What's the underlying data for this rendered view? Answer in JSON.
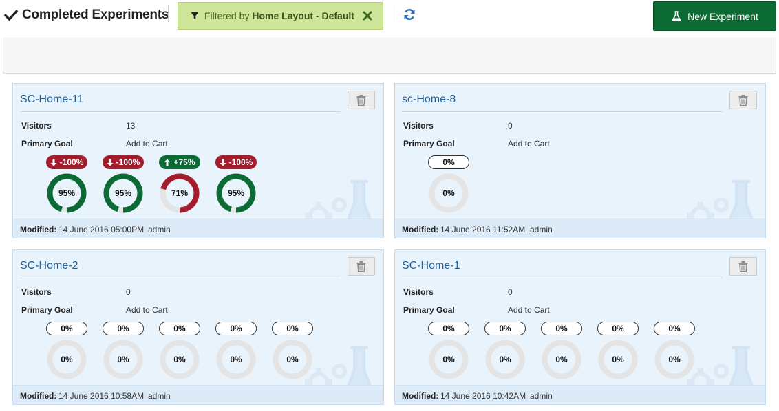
{
  "header": {
    "title": "Completed Experiments",
    "filter_prefix": "Filtered by",
    "filter_value": "Home Layout - Default",
    "new_experiment_label": "New Experiment"
  },
  "icons": {
    "title": "check-icon",
    "filter": "funnel-icon",
    "filter_clear": "close-icon",
    "refresh": "refresh-icon",
    "new_experiment": "flask-icon",
    "delete": "trash-icon"
  },
  "colors": {
    "success": "#0c6a34",
    "danger": "#a31d2c",
    "chip_bg": "#cde69a",
    "link": "#1f5f97",
    "ring_empty": "#e4e4e4"
  },
  "cards": [
    {
      "name": "SC-Home-11",
      "visitors_label": "Visitors",
      "visitors": "13",
      "goal_label": "Primary Goal",
      "goal": "Add to Cart",
      "modified_label": "Modified:",
      "modified": "14 June 2016 05:00PM",
      "user": "admin",
      "variants": [
        {
          "badge": "-100%",
          "trend": "down",
          "ring": "95%",
          "pct": 95,
          "color": "#0c6a34"
        },
        {
          "badge": "-100%",
          "trend": "down",
          "ring": "95%",
          "pct": 95,
          "color": "#0c6a34"
        },
        {
          "badge": "+75%",
          "trend": "up",
          "ring": "71%",
          "pct": 71,
          "color": "#a31d2c"
        },
        {
          "badge": "-100%",
          "trend": "down",
          "ring": "95%",
          "pct": 95,
          "color": "#0c6a34"
        }
      ]
    },
    {
      "name": "sc-Home-8",
      "visitors_label": "Visitors",
      "visitors": "0",
      "goal_label": "Primary Goal",
      "goal": "Add to Cart",
      "modified_label": "Modified:",
      "modified": "14 June 2016 11:52AM",
      "user": "admin",
      "variants": [
        {
          "badge": "0%",
          "trend": "none",
          "ring": "0%",
          "pct": 0,
          "color": "#e4e4e4"
        }
      ]
    },
    {
      "name": "SC-Home-2",
      "visitors_label": "Visitors",
      "visitors": "0",
      "goal_label": "Primary Goal",
      "goal": "Add to Cart",
      "modified_label": "Modified:",
      "modified": "14 June 2016 10:58AM",
      "user": "admin",
      "variants": [
        {
          "badge": "0%",
          "trend": "none",
          "ring": "0%",
          "pct": 0,
          "color": "#e4e4e4"
        },
        {
          "badge": "0%",
          "trend": "none",
          "ring": "0%",
          "pct": 0,
          "color": "#e4e4e4"
        },
        {
          "badge": "0%",
          "trend": "none",
          "ring": "0%",
          "pct": 0,
          "color": "#e4e4e4"
        },
        {
          "badge": "0%",
          "trend": "none",
          "ring": "0%",
          "pct": 0,
          "color": "#e4e4e4"
        },
        {
          "badge": "0%",
          "trend": "none",
          "ring": "0%",
          "pct": 0,
          "color": "#e4e4e4"
        }
      ]
    },
    {
      "name": "SC-Home-1",
      "visitors_label": "Visitors",
      "visitors": "0",
      "goal_label": "Primary Goal",
      "goal": "Add to Cart",
      "modified_label": "Modified:",
      "modified": "14 June 2016 10:42AM",
      "user": "admin",
      "variants": [
        {
          "badge": "0%",
          "trend": "none",
          "ring": "0%",
          "pct": 0,
          "color": "#e4e4e4"
        },
        {
          "badge": "0%",
          "trend": "none",
          "ring": "0%",
          "pct": 0,
          "color": "#e4e4e4"
        },
        {
          "badge": "0%",
          "trend": "none",
          "ring": "0%",
          "pct": 0,
          "color": "#e4e4e4"
        },
        {
          "badge": "0%",
          "trend": "none",
          "ring": "0%",
          "pct": 0,
          "color": "#e4e4e4"
        },
        {
          "badge": "0%",
          "trend": "none",
          "ring": "0%",
          "pct": 0,
          "color": "#e4e4e4"
        }
      ]
    }
  ]
}
